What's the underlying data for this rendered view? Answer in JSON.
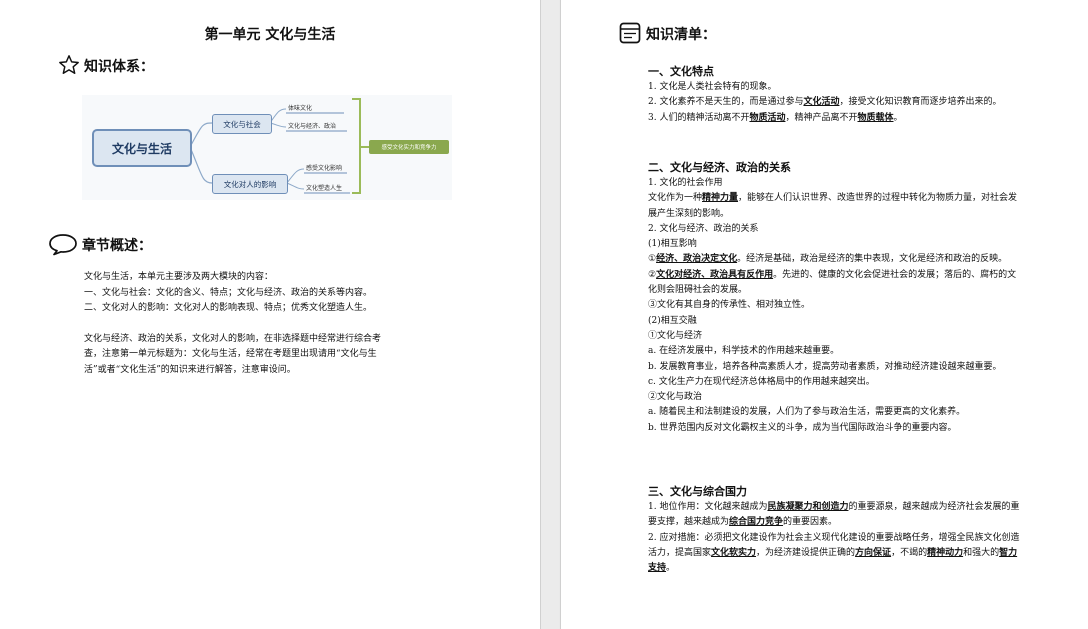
{
  "left": {
    "title": "第一单元  文化与生活",
    "knowledge_system_label": "知识体系：",
    "mindmap": {
      "root": "文化与生活",
      "branch1": "文化与社会",
      "branch1_leaf1": "体味文化",
      "branch1_leaf2": "文化与经济、政治",
      "branch2": "文化对人的影响",
      "branch2_leaf1": "感受文化影响",
      "branch2_leaf2": "文化塑造人生",
      "summary": "感受文化实力和竞争力"
    },
    "overview_label": "章节概述：",
    "overview": [
      "文化与生活，本单元主要涉及两大模块的内容：",
      "一、文化与社会：文化的含义、特点；文化与经济、政治的关系等内容。",
      "二、文化对人的影响：文化对人的影响表现、特点；优秀文化塑造人生。",
      "",
      "文化与经济、政治的关系，文化对人的影响，在非选择题中经常进行综合考",
      "查，注意第一单元标题为：文化与生活，经常在考题里出现请用“文化与生",
      "活”或者“文化生活”的知识来进行解答，注意审设问。"
    ]
  },
  "right": {
    "checklist_label": "知识清单：",
    "s1_title": "一、文化特点",
    "s1_1": "1. 文化是人类社会特有的现象。",
    "s1_2a": "2. 文化素养不是天生的，而是通过参与",
    "s1_2u": "文化活动",
    "s1_2b": "，接受文化知识教育而逐步培养出来的。",
    "s1_3a": "3. 人们的精神活动离不开",
    "s1_3u1": "物质活动",
    "s1_3b": "，精神产品离不开",
    "s1_3u2": "物质载体",
    "s1_3c": "。",
    "s2_title": "二、文化与经济、政治的关系",
    "s2_1": "1. 文化的社会作用",
    "s2_2a": "文化作为一种",
    "s2_2u": "精神力量",
    "s2_2b": "，能够在人们认识世界、改造世界的过程中转化为物质力量，对社会发展产生深刻的影响。",
    "s2_3": "2. 文化与经济、政治的关系",
    "s2_4": "(1)相互影响",
    "s2_5a": "①",
    "s2_5u": "经济、政治决定文化",
    "s2_5b": "。经济是基础，政治是经济的集中表现，文化是经济和政治的反映。",
    "s2_6a": "②",
    "s2_6u": "文化对经济、政治具有反作用",
    "s2_6b": "。先进的、健康的文化会促进社会的发展；落后的、腐朽的文化则会阻碍社会的发展。",
    "s2_7": "③文化有其自身的传承性、相对独立性。",
    "s2_8": "(2)相互交融",
    "s2_9": "①文化与经济",
    "s2_10": "a. 在经济发展中，科学技术的作用越来越重要。",
    "s2_11": "b. 发展教育事业，培养各种高素质人才，提高劳动者素质，对推动经济建设越来越重要。",
    "s2_12": "c. 文化生产力在现代经济总体格局中的作用越来越突出。",
    "s2_13": "②文化与政治",
    "s2_14": "a. 随着民主和法制建设的发展，人们为了参与政治生活，需要更高的文化素养。",
    "s2_15": "b. 世界范围内反对文化霸权主义的斗争，成为当代国际政治斗争的重要内容。",
    "s3_title": "三、文化与综合国力",
    "s3_1a": "1. 地位作用：文化越来越成为",
    "s3_1u1": "民族凝聚力和创造力",
    "s3_1b": "的重要源泉，越来越成为经济社会发展的重要支撑，越来越成为",
    "s3_1u2": "综合国力竞争",
    "s3_1c": "的重要因素。",
    "s3_2a": "2. 应对措施：必须把文化建设作为社会主义现代化建设的重要战略任务，增强全民族文化创造活力，提高国家",
    "s3_2u1": "文化软实力",
    "s3_2b": "，为经济建设提供正确的",
    "s3_2u2": "方向保证",
    "s3_2c": "，不竭的",
    "s3_2u3": "精神动力",
    "s3_2d": "和强大的",
    "s3_2u4": "智力支持",
    "s3_2e": "。"
  },
  "icons": {
    "star": "star-icon",
    "speech": "speech-bubble-icon",
    "checklist": "checklist-icon"
  },
  "colors": {
    "mindmap_node_fill": "#dce6f1",
    "mindmap_node_border": "#6f8fb8",
    "mindmap_summary": "#8aa84e",
    "bracket": "#9bbb59"
  }
}
